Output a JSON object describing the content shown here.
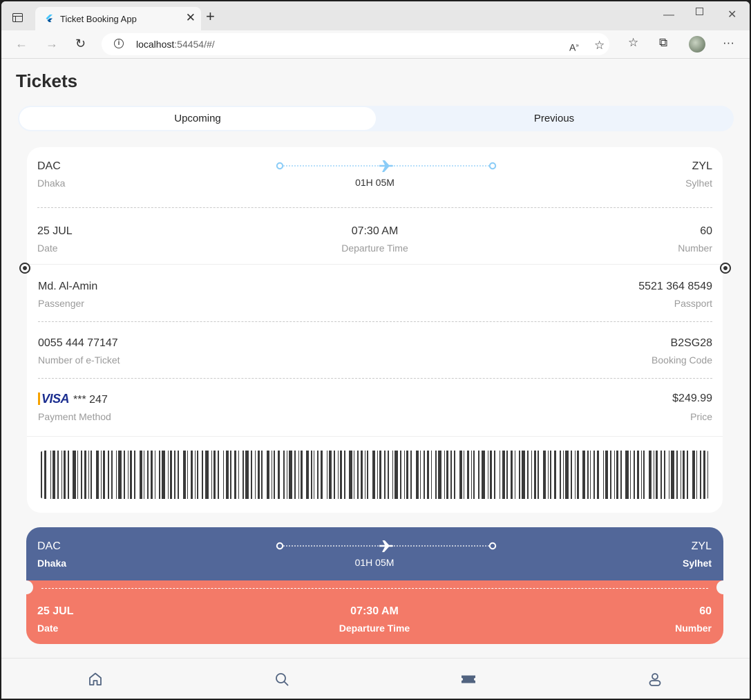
{
  "browser": {
    "tab_title": "Ticket Booking App",
    "url_host": "localhost",
    "url_rest": ":54454/#/"
  },
  "page": {
    "title": "Tickets"
  },
  "segments": {
    "upcoming": "Upcoming",
    "previous": "Previous",
    "selected": "Upcoming"
  },
  "ticket": {
    "from_code": "DAC",
    "from_city": "Dhaka",
    "to_code": "ZYL",
    "to_city": "Sylhet",
    "duration": "01H 05M",
    "date": "25 JUL",
    "date_label": "Date",
    "time": "07:30 AM",
    "time_label": "Departure Time",
    "number": "60",
    "number_label": "Number",
    "passenger": "Md. Al-Amin",
    "passenger_label": "Passenger",
    "passport": "5521 364 8549",
    "passport_label": "Passport",
    "eticket": "0055 444 77147",
    "eticket_label": "Number of e-Ticket",
    "booking_code": "B2SG28",
    "booking_code_label": "Booking Code",
    "card_brand": "VISA",
    "card_masked": "*** 247",
    "payment_label": "Payment Method",
    "price": "$249.99",
    "price_label": "Price"
  },
  "ticket2": {
    "from_code": "DAC",
    "from_city": "Dhaka",
    "to_code": "ZYL",
    "to_city": "Sylhet",
    "duration": "01H 05M",
    "date": "25 JUL",
    "date_label": "Date",
    "time": "07:30 AM",
    "time_label": "Departure Time",
    "number": "60",
    "number_label": "Number"
  },
  "colors": {
    "accent_blue": "#8ACCF7",
    "card2_top": "#526799",
    "card2_bottom": "#F37A68",
    "selected_nav": "#526480"
  },
  "bottom_nav": [
    "home-icon",
    "search-icon",
    "ticket-icon",
    "profile-icon"
  ]
}
